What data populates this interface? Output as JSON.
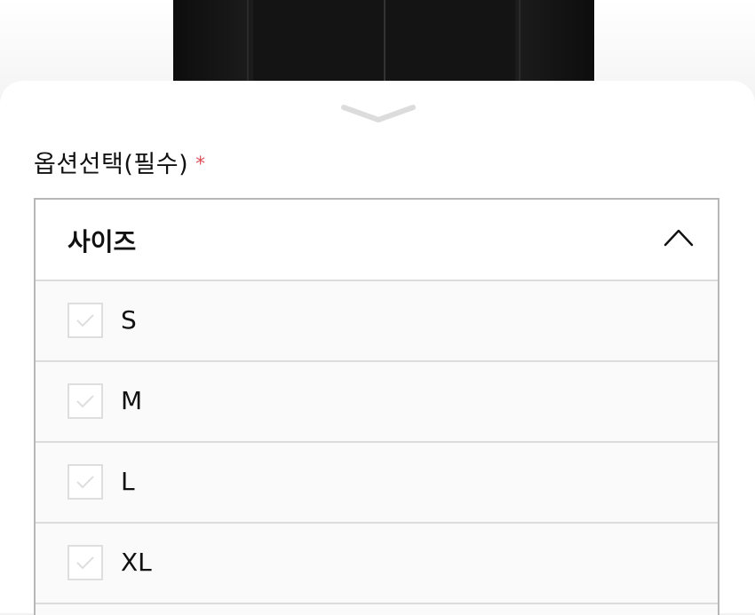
{
  "section": {
    "title": "옵션선택(필수)",
    "required_mark": "*"
  },
  "dropdown": {
    "label": "사이즈",
    "expanded": true,
    "options": [
      {
        "label": "S",
        "checked": false
      },
      {
        "label": "M",
        "checked": false
      },
      {
        "label": "L",
        "checked": false
      },
      {
        "label": "XL",
        "checked": false
      }
    ]
  },
  "icons": {
    "handle": "chevron-down-icon",
    "toggle": "chevron-up-icon",
    "option_check": "check-icon"
  },
  "colors": {
    "required": "#e0505a",
    "border": "#b7b7b7",
    "divider": "#dcdcdc",
    "check": "#dedede"
  }
}
